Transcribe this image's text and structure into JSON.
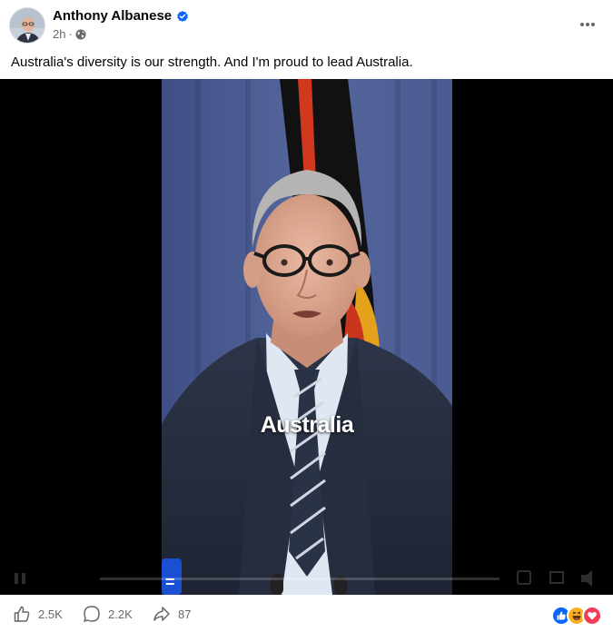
{
  "post": {
    "author": "Anthony Albanese",
    "time": "2h",
    "time_separator": "·",
    "caption": "Australia's diversity is our strength. And I'm proud to lead Australia."
  },
  "video": {
    "subtitle": "Australia"
  },
  "actions": {
    "likes": "2.5K",
    "comments": "2.2K",
    "shares": "87"
  },
  "icons": {
    "verified": "verified-badge-icon",
    "audience": "globe-icon",
    "more": "more-options-icon",
    "like": "thumbs-up-icon",
    "comment": "comment-bubble-icon",
    "share": "share-arrow-icon",
    "reactions": [
      "like-reaction-icon",
      "haha-reaction-icon",
      "love-reaction-icon"
    ]
  },
  "colors": {
    "verified": "#0866ff",
    "secondary_text": "#65676b",
    "like": "#0866ff",
    "love": "#f33e58",
    "haha": "#f7b125"
  }
}
